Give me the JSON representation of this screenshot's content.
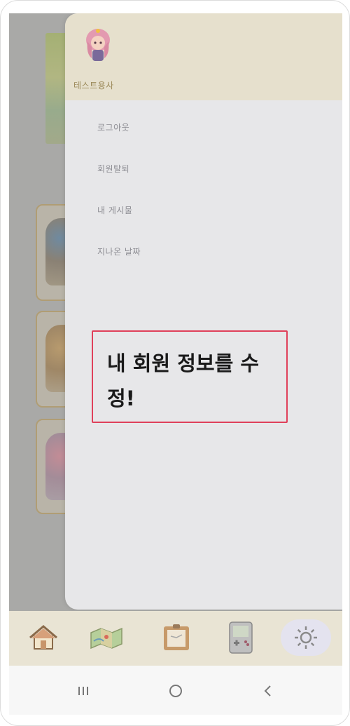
{
  "drawer": {
    "username": "테스트용사",
    "menu_items": [
      {
        "label": "로그아웃"
      },
      {
        "label": "회원탈퇴"
      },
      {
        "label": "내 게시물"
      },
      {
        "label": "지나온 날짜"
      }
    ]
  },
  "callout": {
    "text": "내 회원 정보를 수정!",
    "border_color": "#e0405a"
  },
  "bottom_nav": {
    "items": [
      {
        "icon": "home-icon"
      },
      {
        "icon": "map-icon"
      },
      {
        "icon": "board-icon"
      },
      {
        "icon": "game-console-icon"
      },
      {
        "icon": "settings-gear-icon",
        "active": true
      }
    ]
  },
  "colors": {
    "drawer_header_bg": "#e6e0cd",
    "drawer_bg": "#e7e7e9",
    "bottom_nav_bg": "#e9e4d4",
    "username_color": "#9c8a5a"
  }
}
